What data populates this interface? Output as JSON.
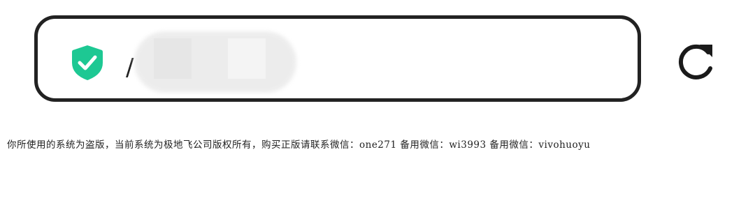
{
  "address_bar": {
    "secure_icon": "shield-check-icon",
    "url_visible_prefix": "/",
    "url_obscured": true,
    "accent_color": "#1dc893"
  },
  "toolbar": {
    "reload_icon": "reload-icon"
  },
  "notice": {
    "text": "你所使用的系统为盗版，当前系统为极地飞公司版权所有，购买正版请联系微信：one271 备用微信：wi3993 备用微信：vivohuoyu"
  }
}
